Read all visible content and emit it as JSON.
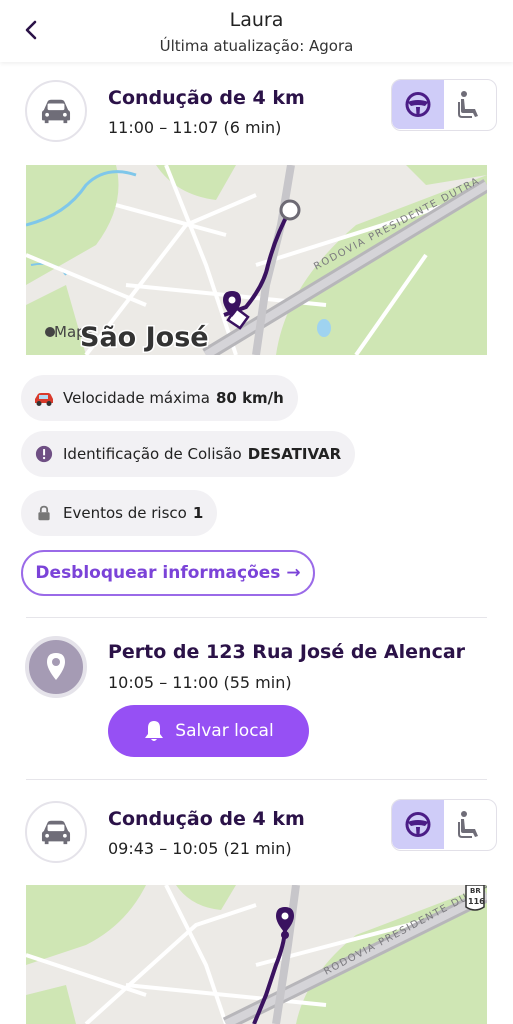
{
  "header": {
    "title": "Laura",
    "subtitle": "Última atualização: Agora"
  },
  "trips": [
    {
      "title": "Condução de 4 km",
      "time": "11:00 – 11:07 (6 min)"
    },
    {
      "title": "Condução de 4 km",
      "time": "09:43 – 10:05 (21 min)"
    }
  ],
  "map1": {
    "attribution": "Maps",
    "city_label": "São José",
    "road_label": "RODOVIA PRESIDENTE DUTRA"
  },
  "map2": {
    "road_label": "RODOVIA PRESIDENTE DUTRA",
    "shield_top": "BR",
    "shield_num": "116"
  },
  "stats": {
    "speed_label": "Velocidade máxima",
    "speed_value": "80 km/h",
    "collision_label": "Identificação de Colisão",
    "collision_value": "DESATIVAR",
    "risk_label": "Eventos de risco",
    "risk_value": "1"
  },
  "unlock_label": "Desbloquear informações →",
  "place": {
    "title": "Perto de 123 Rua José de Alencar",
    "time": "10:05 – 11:00 (55 min)",
    "save_label": "Salvar local"
  },
  "colors": {
    "accent": "#9650f4",
    "title": "#2b1248",
    "toggle_selected": "#cfccf8"
  },
  "icons": [
    "back-arrow-icon",
    "car-icon",
    "steering-wheel-icon",
    "passenger-seat-icon",
    "location-pin-icon",
    "bell-icon",
    "lock-icon",
    "exclamation-icon",
    "red-car-icon"
  ]
}
